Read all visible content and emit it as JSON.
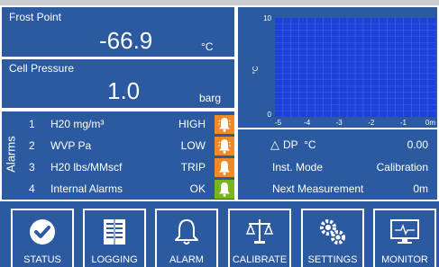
{
  "frost_point": {
    "title": "Frost Point",
    "value": "-66.9",
    "unit": "°C"
  },
  "cell_pressure": {
    "title": "Cell Pressure",
    "value": "1.0",
    "unit": "barg"
  },
  "alarms": {
    "heading": "Alarms",
    "rows": [
      {
        "num": "1",
        "name": "H20 mg/m³",
        "state": "HIGH",
        "color": "#f08a24",
        "icon": "ringing-bell-icon"
      },
      {
        "num": "2",
        "name": "WVP Pa",
        "state": "LOW",
        "color": "#f08a24",
        "icon": "ringing-bell-icon"
      },
      {
        "num": "3",
        "name": "H20 lbs/MMscf",
        "state": "TRIP",
        "color": "#f08a24",
        "icon": "bell-icon"
      },
      {
        "num": "4",
        "name": "Internal Alarms",
        "state": "OK",
        "color": "#7ab51d",
        "icon": "bell-icon"
      }
    ]
  },
  "chart_data": {
    "type": "line",
    "ylabel": "°C",
    "xlim": [
      -5,
      0
    ],
    "ylim": [
      0,
      10
    ],
    "y_ticks": [
      "10",
      "0"
    ],
    "x_ticks": [
      "-5",
      "-4",
      "-3",
      "-2",
      "-1",
      "0m"
    ],
    "grid": true,
    "series": [],
    "colors": {
      "plot_bg": "#1f3fd6",
      "grid": "#3f63f0"
    }
  },
  "info": {
    "dp_label": "DP  °C",
    "dp_value": "0.00",
    "mode_label": "Inst. Mode",
    "mode_value": "Calibration",
    "next_label": "Next Measurement",
    "next_value": "0m"
  },
  "buttons": [
    {
      "label": "STATUS",
      "icon": "check-circle-icon"
    },
    {
      "label": "LOGGING",
      "icon": "book-icon"
    },
    {
      "label": "ALARM",
      "icon": "bell-icon"
    },
    {
      "label": "CALIBRATE",
      "icon": "scales-icon"
    },
    {
      "label": "SETTINGS",
      "icon": "gears-icon"
    },
    {
      "label": "MONITOR",
      "icon": "monitor-icon"
    }
  ],
  "colors": {
    "background": "#2b5aa0",
    "warning": "#f08a24",
    "ok": "#7ab51d"
  }
}
